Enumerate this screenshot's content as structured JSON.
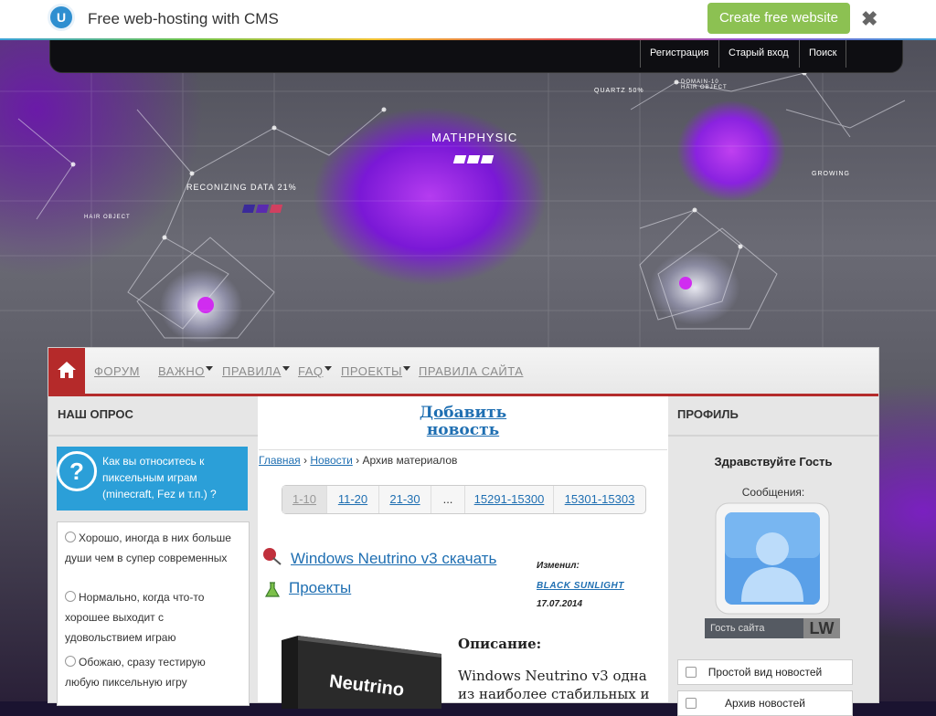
{
  "ubar": {
    "logo_letter": "U",
    "title": "Free web-hosting with CMS",
    "cta": "Create free website",
    "close_glyph": "✖"
  },
  "header": {
    "links": [
      "Регистрация",
      "Старый вход",
      "Поиск"
    ]
  },
  "banner": {
    "center_label": "MATHPHYSIC",
    "left_label": "RECONIZING DATA 21%",
    "right_label": "GROWING",
    "top_label": "QUARTZ 50%",
    "top_right_label": "DOMAIN-10 HAIR OBJECT",
    "left_small": "HAIR OBJECT"
  },
  "nav": {
    "items": [
      {
        "label": "ФОРУМ",
        "dropdown": false
      },
      {
        "label": "ВАЖНО",
        "dropdown": true
      },
      {
        "label": "ПРАВИЛА",
        "dropdown": true
      },
      {
        "label": "FAQ",
        "dropdown": true
      },
      {
        "label": "ПРОЕКТЫ",
        "dropdown": true
      },
      {
        "label": "ПРАВИЛА САЙТА",
        "dropdown": false
      }
    ]
  },
  "left": {
    "title": "НАШ ОПРОС",
    "question": "Как вы относитесь к пиксельным играм (minecraft, Fez и т.п.) ?",
    "options": [
      "Хорошо, иногда в них больше души чем в супер современных",
      "Нормально, когда что-то хорошее выходит с удовольствием играю",
      "Обожаю, сразу тестирую любую пиксельную игру"
    ]
  },
  "center": {
    "add_news_line1": "Добавить",
    "add_news_line2": "новость",
    "crumbs": {
      "home": "Главная",
      "sep1": " › ",
      "news": "Новости",
      "sep2": " › ",
      "current": "Архив материалов"
    },
    "pager": [
      "1-10",
      "11-20",
      "21-30",
      "...",
      "15291-15300",
      "15301-15303"
    ],
    "post": {
      "title": "Windows Neutrino v3 скачать",
      "category": "Проекты",
      "edited_label": "Изменил:",
      "author": "Black Sunlight",
      "date": "17.07.2014",
      "desc_heading": "Описание:",
      "desc_text": "Windows Neutrino v3 одна из наиболее стабильных и",
      "box_text": "Neutrino"
    }
  },
  "right": {
    "title": "ПРОФИЛЬ",
    "greeting": "Здравствуйте Гость",
    "messages": "Сообщения:",
    "avatar_label": "Гость сайта",
    "avatar_badge": "LW",
    "buttons": [
      "Простой вид новостей",
      "Архив новостей"
    ]
  },
  "colors": {
    "accent": "#b52a2a",
    "link": "#1f6fb2",
    "poll": "#2b9fd8",
    "cta": "#8cc152"
  }
}
